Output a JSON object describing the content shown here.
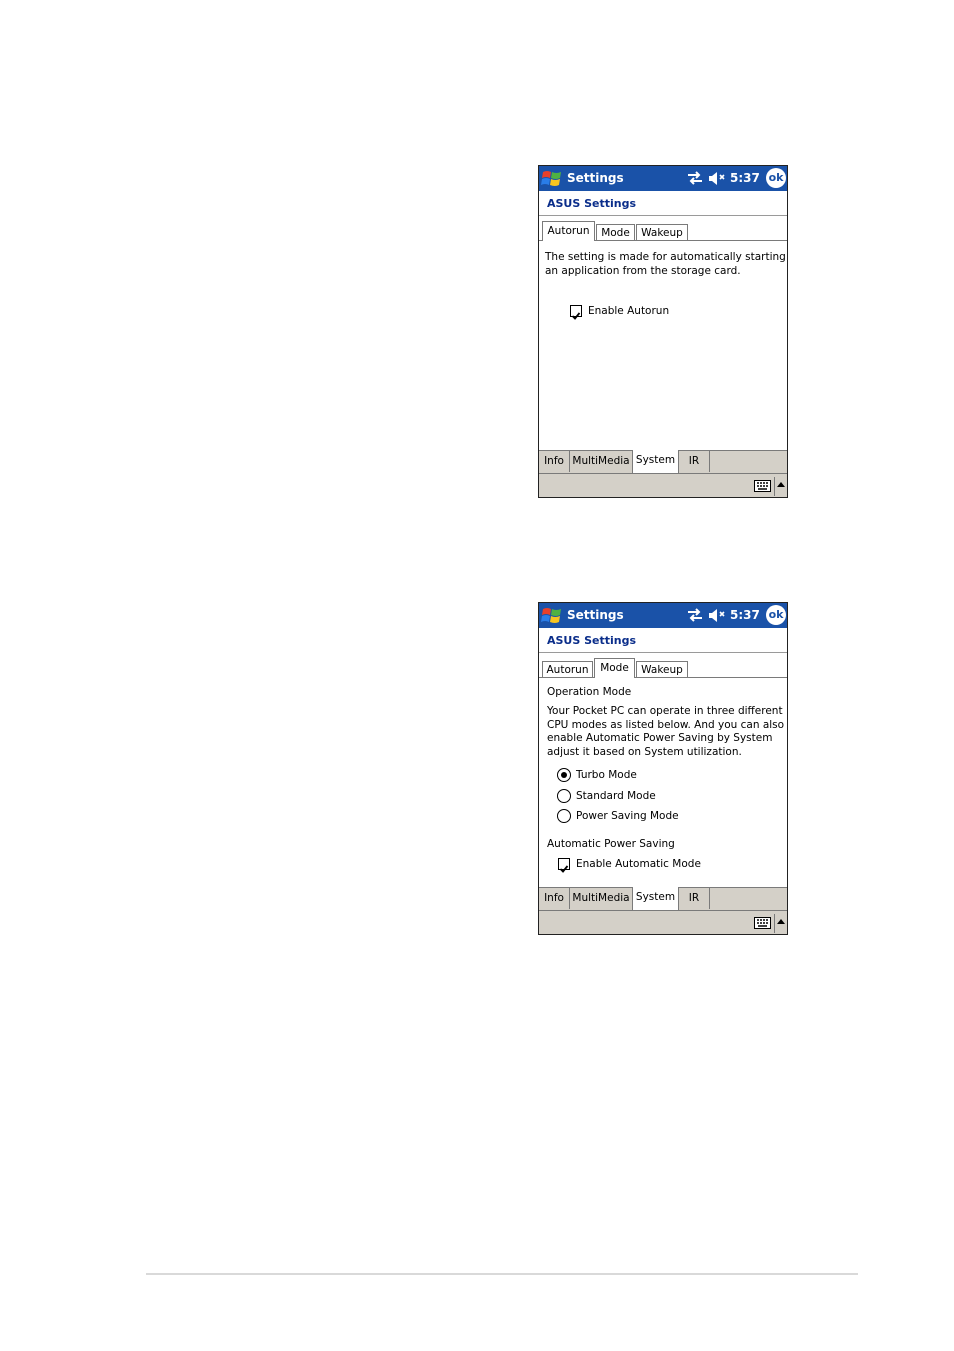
{
  "screens": [
    {
      "title": "Settings",
      "clock": "5:37",
      "ok_label": "ok",
      "heading": "ASUS Settings",
      "tabs": [
        "Autorun",
        "Mode",
        "Wakeup"
      ],
      "active_tab": "Autorun",
      "description": [
        "The setting is made for automatically starting",
        "an application from the storage card."
      ],
      "checkbox": {
        "label": "Enable Autorun",
        "checked": true
      },
      "bottom_tabs": [
        "Info",
        "MultiMedia",
        "System",
        "IR"
      ],
      "active_bottom_tab": "System"
    },
    {
      "title": "Settings",
      "clock": "5:37",
      "ok_label": "ok",
      "heading": "ASUS Settings",
      "tabs": [
        "Autorun",
        "Mode",
        "Wakeup"
      ],
      "active_tab": "Mode",
      "section1_label": "Operation Mode",
      "description": [
        "Your Pocket PC can operate in three different",
        "CPU modes as listed below. And you can also",
        "enable Automatic Power Saving by System",
        "adjust it based on System utilization."
      ],
      "radios": [
        {
          "label": "Turbo Mode",
          "selected": true
        },
        {
          "label": "Standard Mode",
          "selected": false
        },
        {
          "label": "Power Saving Mode",
          "selected": false
        }
      ],
      "section2_label": "Automatic Power Saving",
      "checkbox": {
        "label": "Enable Automatic Mode",
        "checked": true
      },
      "bottom_tabs": [
        "Info",
        "MultiMedia",
        "System",
        "IR"
      ],
      "active_bottom_tab": "System"
    }
  ],
  "icons": {
    "start": "windows-flag-icon",
    "connectivity": "connectivity-icon",
    "volume": "speaker-muted-icon",
    "keyboard": "keyboard-icon",
    "sip_arrow": "up-arrow-icon"
  },
  "colors": {
    "title_bar": "#1a52a8",
    "heading_text": "#0a2d8a",
    "bottom_bar": "#d4d0c8"
  }
}
